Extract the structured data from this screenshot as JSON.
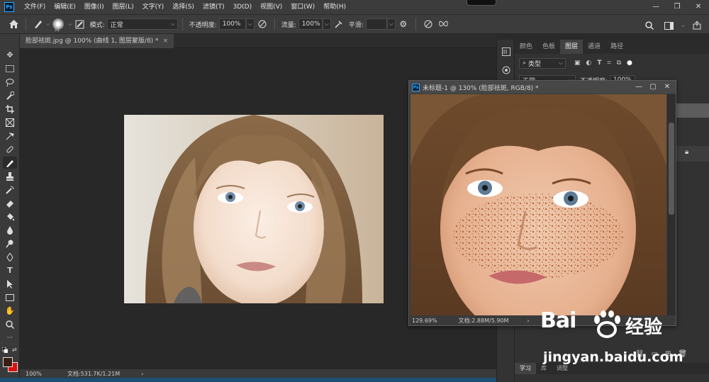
{
  "menubar": {
    "logo": "Ps",
    "items": [
      "文件(F)",
      "编辑(E)",
      "图像(I)",
      "图层(L)",
      "文字(Y)",
      "选择(S)",
      "滤镜(T)",
      "3D(D)",
      "视图(V)",
      "窗口(W)",
      "帮助(H)"
    ],
    "window_controls": [
      "—",
      "❐",
      "✕"
    ]
  },
  "optionsbar": {
    "brush_size": "31",
    "mode_label": "模式:",
    "mode_value": "正常",
    "opacity_label": "不透明度:",
    "opacity_value": "100%",
    "flow_label": "流量:",
    "flow_value": "100%",
    "smooth_label": "平滑:",
    "smooth_value": ""
  },
  "document": {
    "tab_title": "脸部祛斑.jpg @ 100% (曲线 1, 图层蒙版/8) *",
    "tab_close": "×",
    "zoom": "100%",
    "doc_size": "文档:531.7K/1.21M"
  },
  "floating_window": {
    "logo": "Ps",
    "title": "未标题-1 @ 130% (脸部祛斑, RGB/8) *",
    "controls": [
      "—",
      "▢",
      "✕"
    ],
    "zoom": "129.69%",
    "doc_size": "文档:2.88M/5.90M"
  },
  "panel": {
    "tabs": [
      "颜色",
      "色板",
      "图层",
      "通道",
      "路径"
    ],
    "active_tab": "图层",
    "filter_label": "类型",
    "blend_mode": "正常",
    "opacity_label": "不透明度:",
    "opacity_value": "100%",
    "bottom_tabs": [
      "学习",
      "库",
      "调整"
    ]
  },
  "watermark": {
    "brand": "Bai",
    "brand_tail": "经验",
    "url": "jingyan.baidu.com"
  },
  "colors": {
    "foreground": "#3a1e14",
    "background": "#e01010"
  }
}
